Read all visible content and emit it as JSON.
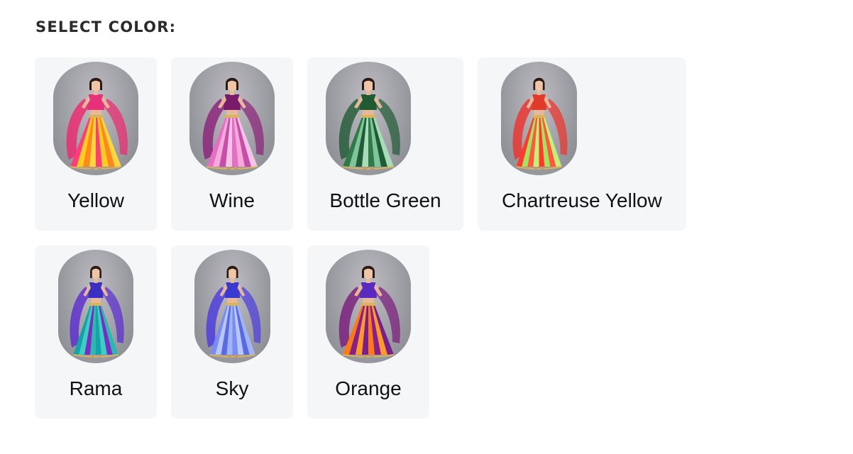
{
  "heading": "SELECT COLOR:",
  "swatches": [
    {
      "name": "Yellow",
      "top_color": "#e8307a",
      "skirt_colors": [
        "#ff3c7a",
        "#ffcc22",
        "#ff8a1c",
        "#ffd640"
      ],
      "dupatta_color": "#f0266e"
    },
    {
      "name": "Wine",
      "top_color": "#7a1a6a",
      "skirt_colors": [
        "#e56fc4",
        "#f7a8dc",
        "#c74ea8",
        "#f3c3e8"
      ],
      "dupatta_color": "#8a1f78"
    },
    {
      "name": "Bottle Green",
      "top_color": "#1e5a32",
      "skirt_colors": [
        "#2f7a46",
        "#7fc49a",
        "#1f5c35",
        "#a8dcb8"
      ],
      "dupatta_color": "#1f5a34"
    },
    {
      "name": "Chartreuse Yellow",
      "top_color": "#e13a2a",
      "skirt_colors": [
        "#ff3b2c",
        "#a8e060",
        "#ff5a3c",
        "#c4f07a"
      ],
      "dupatta_color": "#f0302a"
    },
    {
      "name": "Rama",
      "top_color": "#3a2fc0",
      "skirt_colors": [
        "#16a3a8",
        "#3ad0c8",
        "#7a2cc4",
        "#2ab8b0"
      ],
      "dupatta_color": "#5a2ad0"
    },
    {
      "name": "Sky",
      "top_color": "#3a3ad0",
      "skirt_colors": [
        "#7a8cf0",
        "#b8c8ff",
        "#5a6ae0",
        "#a0b4fa"
      ],
      "dupatta_color": "#4a3ae0"
    },
    {
      "name": "Orange",
      "top_color": "#5a2ac0",
      "skirt_colors": [
        "#ff7a14",
        "#8a1f8a",
        "#ff9a2a",
        "#7a1f8a"
      ],
      "dupatta_color": "#7a1a7a"
    }
  ]
}
